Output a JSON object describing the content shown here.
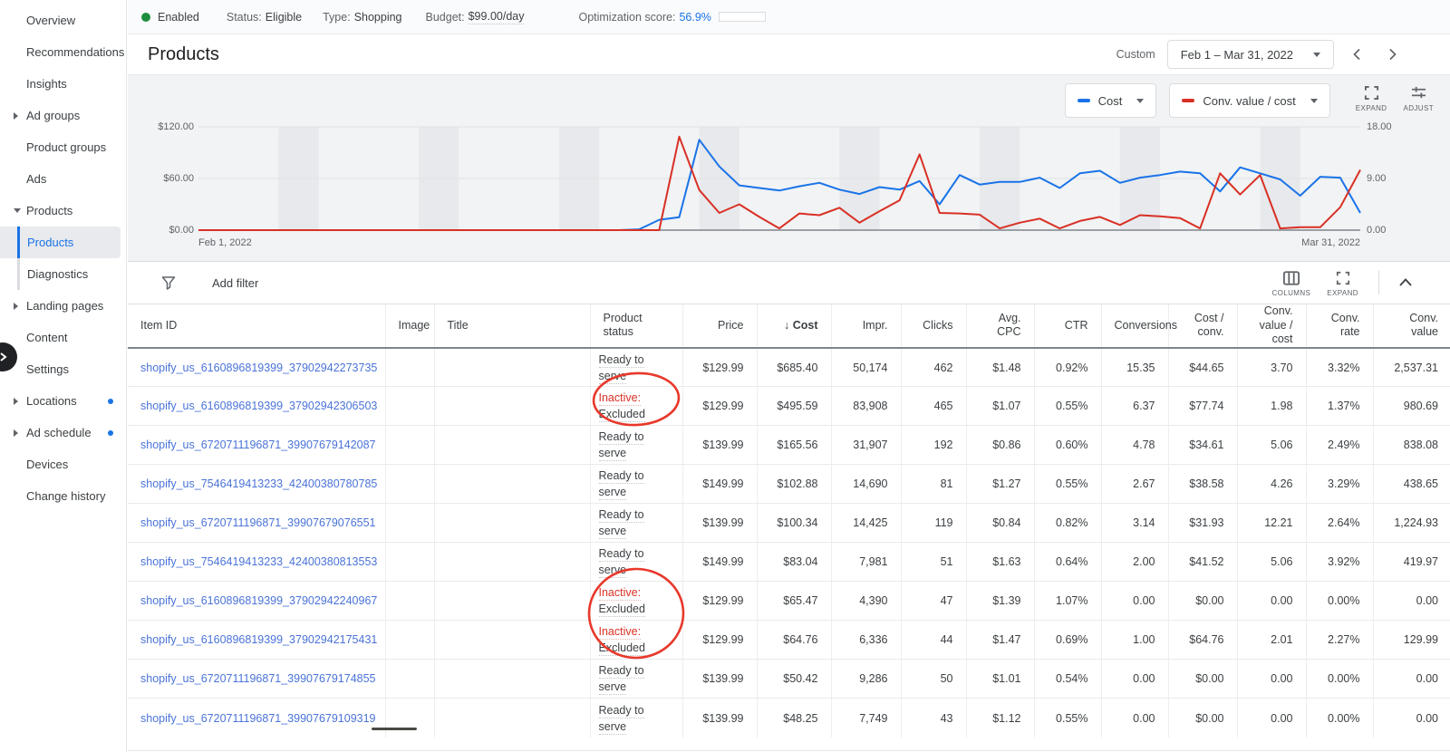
{
  "colors": {
    "blue": "#1a73e8",
    "red": "#d93025",
    "link": "#4a73d8",
    "green": "#1e8e3e",
    "annotation": "#e8382b"
  },
  "sidebar": {
    "items": [
      {
        "label": "Overview"
      },
      {
        "label": "Recommendations"
      },
      {
        "label": "Insights"
      },
      {
        "label": "Ad groups",
        "arrow": "right"
      },
      {
        "label": "Product groups"
      },
      {
        "label": "Ads"
      },
      {
        "label": "Products",
        "arrow": "down"
      },
      {
        "label": "Products",
        "sub": true,
        "selected": true
      },
      {
        "label": "Diagnostics",
        "sub": true
      },
      {
        "label": "Landing pages",
        "arrow": "right"
      },
      {
        "label": "Content"
      },
      {
        "label": "Settings"
      },
      {
        "label": "Locations",
        "arrow": "right",
        "dot": true
      },
      {
        "label": "Ad schedule",
        "arrow": "right",
        "dot": true
      },
      {
        "label": "Devices"
      },
      {
        "label": "Change history"
      }
    ]
  },
  "topbar": {
    "enabled_label": "Enabled",
    "status_label": "Status:",
    "status_value": "Eligible",
    "type_label": "Type:",
    "type_value": "Shopping",
    "budget_label": "Budget:",
    "budget_value": "$99.00/day",
    "optimization_label": "Optimization score:",
    "optimization_value": "56.9%",
    "optimization_fill_pct": 70
  },
  "header": {
    "title": "Products",
    "range_type_label": "Custom",
    "range_value": "Feb 1 – Mar 31, 2022"
  },
  "chart": {
    "expand_label": "EXPAND",
    "adjust_label": "ADJUST"
  },
  "chart_data": {
    "type": "line",
    "title": "",
    "days": 59,
    "x_start_label": "Feb 1, 2022",
    "x_end_label": "Mar 31, 2022",
    "left_axis": {
      "labels": [
        "$120.00",
        "$60.00",
        "$0.00"
      ],
      "max": 120,
      "min": 0
    },
    "right_axis": {
      "labels": [
        "18.00",
        "9.00",
        "0.00"
      ],
      "max": 18,
      "min": 0
    },
    "grid": "horizontal",
    "legend_position": "top-right",
    "weekend_band_days": [
      [
        4,
        6
      ],
      [
        11,
        13
      ],
      [
        18,
        20
      ],
      [
        25,
        27
      ],
      [
        32,
        34
      ],
      [
        39,
        41
      ],
      [
        46,
        48
      ],
      [
        53,
        55
      ]
    ],
    "series": [
      {
        "name": "Cost",
        "color": "#1a73e8",
        "axis": "left",
        "values": [
          0,
          0,
          0,
          0,
          0,
          0,
          0,
          0,
          0,
          0,
          0,
          0,
          0,
          0,
          0,
          0,
          0,
          0,
          0,
          0,
          0,
          0,
          1,
          12,
          15,
          105,
          74,
          52,
          49,
          46,
          51,
          55,
          47,
          42,
          50,
          47,
          57,
          30,
          64,
          53,
          56,
          56,
          61,
          49,
          66,
          69,
          55,
          61,
          64,
          68,
          66,
          45,
          73,
          66,
          59,
          40,
          62,
          61,
          20
        ]
      },
      {
        "name": "Conv. value / cost",
        "color": "#d93025",
        "axis": "right",
        "values": [
          0,
          0,
          0,
          0,
          0,
          0,
          0,
          0,
          0,
          0,
          0,
          0,
          0,
          0,
          0,
          0,
          0,
          0,
          0,
          0,
          0,
          0,
          0,
          0,
          16.3,
          7,
          3,
          4.5,
          2.3,
          0.3,
          2.9,
          2.6,
          3.9,
          1.3,
          3.3,
          5.2,
          13.2,
          3,
          2.9,
          2.7,
          0.3,
          1.3,
          2,
          0.3,
          1.6,
          2.3,
          0.9,
          2.6,
          2.4,
          2.1,
          0.3,
          9.9,
          6.2,
          9.6,
          0.3,
          0.5,
          0.5,
          4,
          10.5
        ]
      }
    ]
  },
  "filter": {
    "add_filter_label": "Add filter",
    "columns_label": "COLUMNS",
    "expand_label": "EXPAND"
  },
  "table": {
    "columns": [
      {
        "label": "Item ID",
        "align": "left"
      },
      {
        "label": "Image",
        "align": "left"
      },
      {
        "label": "Title",
        "align": "left"
      },
      {
        "label": "Product status",
        "align": "left"
      },
      {
        "label": "Price",
        "align": "right"
      },
      {
        "label": "Cost",
        "align": "right",
        "sorted": true
      },
      {
        "label": "Impr.",
        "align": "right"
      },
      {
        "label": "Clicks",
        "align": "right"
      },
      {
        "label": "Avg. CPC",
        "align": "right"
      },
      {
        "label": "CTR",
        "align": "right"
      },
      {
        "label": "Conversions",
        "align": "right"
      },
      {
        "label": "Cost / conv.",
        "align": "right"
      },
      {
        "label": "Conv. value / cost",
        "align": "right"
      },
      {
        "label": "Conv. rate",
        "align": "right"
      },
      {
        "label": "Conv. value",
        "align": "right"
      }
    ],
    "rows": [
      {
        "item_id": "shopify_us_6160896819399_37902942273735",
        "status": [
          "Ready to serve"
        ],
        "circled": false,
        "values": [
          "$129.99",
          "$685.40",
          "50,174",
          "462",
          "$1.48",
          "0.92%",
          "15.35",
          "$44.65",
          "3.70",
          "3.32%",
          "2,537.31"
        ]
      },
      {
        "item_id": "shopify_us_6160896819399_37902942306503",
        "status": [
          "Inactive:",
          "Excluded"
        ],
        "circled": true,
        "values": [
          "$129.99",
          "$495.59",
          "83,908",
          "465",
          "$1.07",
          "0.55%",
          "6.37",
          "$77.74",
          "1.98",
          "1.37%",
          "980.69"
        ]
      },
      {
        "item_id": "shopify_us_6720711196871_39907679142087",
        "status": [
          "Ready to serve"
        ],
        "circled": false,
        "values": [
          "$139.99",
          "$165.56",
          "31,907",
          "192",
          "$0.86",
          "0.60%",
          "4.78",
          "$34.61",
          "5.06",
          "2.49%",
          "838.08"
        ]
      },
      {
        "item_id": "shopify_us_7546419413233_42400380780785",
        "status": [
          "Ready to serve"
        ],
        "circled": false,
        "values": [
          "$149.99",
          "$102.88",
          "14,690",
          "81",
          "$1.27",
          "0.55%",
          "2.67",
          "$38.58",
          "4.26",
          "3.29%",
          "438.65"
        ]
      },
      {
        "item_id": "shopify_us_6720711196871_39907679076551",
        "status": [
          "Ready to serve"
        ],
        "circled": false,
        "values": [
          "$139.99",
          "$100.34",
          "14,425",
          "119",
          "$0.84",
          "0.82%",
          "3.14",
          "$31.93",
          "12.21",
          "2.64%",
          "1,224.93"
        ]
      },
      {
        "item_id": "shopify_us_7546419413233_42400380813553",
        "status": [
          "Ready to serve"
        ],
        "circled": false,
        "values": [
          "$149.99",
          "$83.04",
          "7,981",
          "51",
          "$1.63",
          "0.64%",
          "2.00",
          "$41.52",
          "5.06",
          "3.92%",
          "419.97"
        ]
      },
      {
        "item_id": "shopify_us_6160896819399_37902942240967",
        "status": [
          "Inactive:",
          "Excluded"
        ],
        "circled": true,
        "values": [
          "$129.99",
          "$65.47",
          "4,390",
          "47",
          "$1.39",
          "1.07%",
          "0.00",
          "$0.00",
          "0.00",
          "0.00%",
          "0.00"
        ]
      },
      {
        "item_id": "shopify_us_6160896819399_37902942175431",
        "status": [
          "Inactive:",
          "Excluded"
        ],
        "circled": true,
        "values": [
          "$129.99",
          "$64.76",
          "6,336",
          "44",
          "$1.47",
          "0.69%",
          "1.00",
          "$64.76",
          "2.01",
          "2.27%",
          "129.99"
        ]
      },
      {
        "item_id": "shopify_us_6720711196871_39907679174855",
        "status": [
          "Ready to serve"
        ],
        "circled": false,
        "values": [
          "$139.99",
          "$50.42",
          "9,286",
          "50",
          "$1.01",
          "0.54%",
          "0.00",
          "$0.00",
          "0.00",
          "0.00%",
          "0.00"
        ]
      },
      {
        "item_id": "shopify_us_6720711196871_39907679109319",
        "status": [
          "Ready to serve"
        ],
        "circled": false,
        "values": [
          "$139.99",
          "$48.25",
          "7,749",
          "43",
          "$1.12",
          "0.55%",
          "0.00",
          "$0.00",
          "0.00",
          "0.00%",
          "0.00"
        ]
      }
    ]
  }
}
